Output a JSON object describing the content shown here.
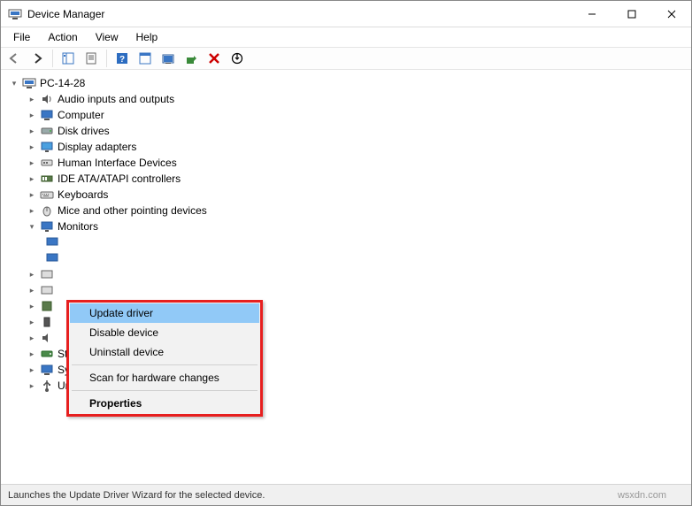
{
  "window": {
    "title": "Device Manager"
  },
  "menubar": [
    "File",
    "Action",
    "View",
    "Help"
  ],
  "tree": {
    "root": "PC-14-28",
    "items": [
      "Audio inputs and outputs",
      "Computer",
      "Disk drives",
      "Display adapters",
      "Human Interface Devices",
      "IDE ATA/ATAPI controllers",
      "Keyboards",
      "Mice and other pointing devices",
      "Monitors",
      "Storage controllers",
      "System devices",
      "Universal Serial Bus controllers"
    ]
  },
  "context_menu": {
    "update": "Update driver",
    "disable": "Disable device",
    "uninstall": "Uninstall device",
    "scan": "Scan for hardware changes",
    "properties": "Properties"
  },
  "statusbar": {
    "text": "Launches the Update Driver Wizard for the selected device.",
    "right": "wsxdn.com"
  }
}
